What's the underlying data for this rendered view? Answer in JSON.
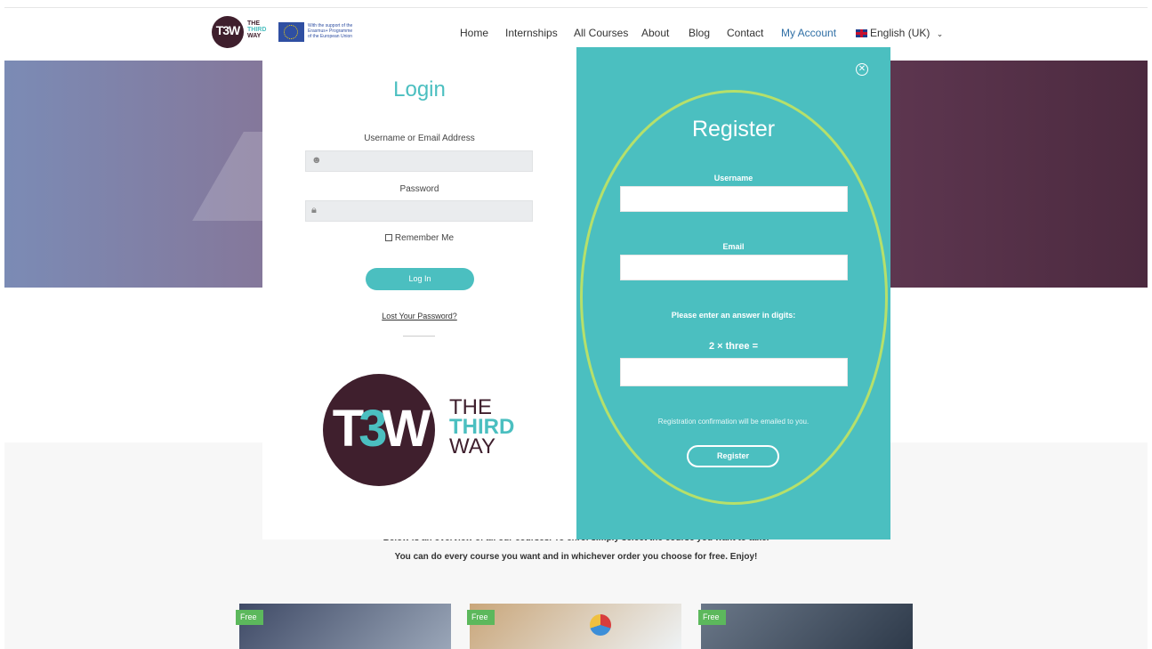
{
  "header": {
    "logo_letters": "T3W",
    "logo_line1": "THE",
    "logo_line2": "THIRD",
    "logo_line3": "WAY",
    "eu_line1": "With the support of the",
    "eu_line2": "Erasmus+ Programme",
    "eu_line3": "of the European Union"
  },
  "nav": {
    "items": [
      "Home",
      "Internships",
      "All Courses",
      "About",
      "Blog",
      "Contact",
      "My Account"
    ],
    "active": "My Account",
    "language": "English (UK)",
    "language_chevron": "chevron-down-icon"
  },
  "login": {
    "title": "Login",
    "username_label": "Username or Email Address",
    "username_icon": "user-icon",
    "password_label": "Password",
    "password_icon": "lock-icon",
    "remember_label": "Remember Me",
    "submit_label": "Log In",
    "lost_password": "Lost Your Password?",
    "logo_letters_a": "T",
    "logo_letters_b": "3",
    "logo_letters_c": "W",
    "logo_text_1": "THE",
    "logo_text_2": "THIRD",
    "logo_text_3": "WAY"
  },
  "register": {
    "title": "Register",
    "username_label": "Username",
    "email_label": "Email",
    "captcha_instruction": "Please enter an answer in digits:",
    "captcha_question": "2 × three =",
    "note": "Registration confirmation will be emailed to you.",
    "submit_label": "Register",
    "close_icon": "close-circle-icon"
  },
  "courses": {
    "intro_line1": "Below is an overview of all our courses. To enrol simply select the course you want to take.",
    "intro_line2": "You can do every course you want and in whichever order you choose for free. Enjoy!",
    "badges": [
      "Free",
      "Free",
      "Free"
    ]
  },
  "colors": {
    "brand_teal": "#4bbfc0",
    "brand_plum": "#3f1f2d",
    "highlight": "#b6e06a",
    "nav_active": "#2f6fa5",
    "badge_green": "#5cb85c"
  }
}
